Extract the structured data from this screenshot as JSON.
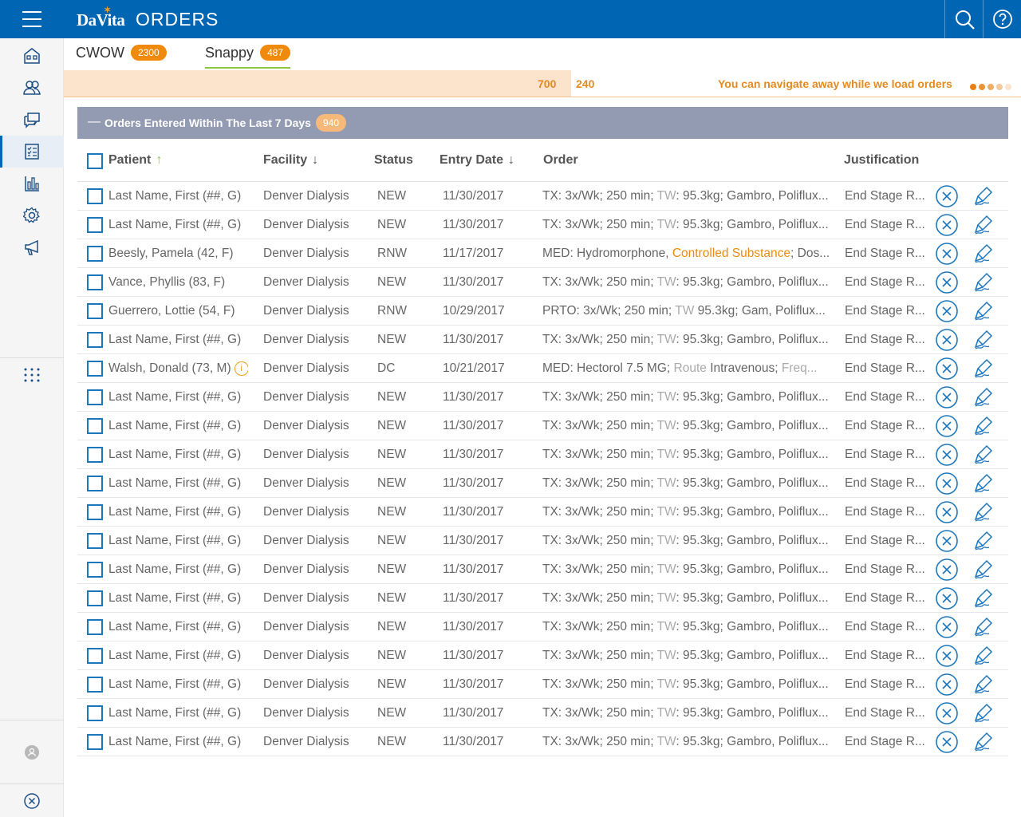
{
  "app": {
    "brand": "DaVita",
    "title": "ORDERS"
  },
  "topbar": {
    "search_icon": "search-icon",
    "help_icon": "help-icon"
  },
  "sidebar": {
    "items": [
      "home-icon",
      "patients-icon",
      "messages-icon",
      "orders-icon",
      "reports-icon",
      "settings-icon",
      "announcements-icon",
      "apps-grid-icon",
      "user-avatar",
      "close-icon"
    ],
    "active": "orders-icon"
  },
  "tabs": [
    {
      "label": "CWOW",
      "count": "2300"
    },
    {
      "label": "Snappy",
      "count": "487"
    }
  ],
  "loading": {
    "loaded_count": "700",
    "remaining_count": "240",
    "message": "You can navigate away while we load orders",
    "progress_fraction": 0.53
  },
  "group": {
    "title": "Orders Entered Within The Last 7 Days",
    "count": "940"
  },
  "columns": {
    "patient": "Patient",
    "facility": "Facility",
    "status": "Status",
    "entry_date": "Entry Date",
    "order": "Order",
    "justification": "Justification"
  },
  "rows": [
    {
      "patient": "Last Name, First (##, G)",
      "facility": "Denver Dialysis",
      "status": "NEW",
      "date": "11/30/2017",
      "order_type": "tx",
      "justification": "End Stage R..."
    },
    {
      "patient": "Last Name, First (##, G)",
      "facility": "Denver Dialysis",
      "status": "NEW",
      "date": "11/30/2017",
      "order_type": "tx",
      "justification": "End Stage R..."
    },
    {
      "patient": "Beesly, Pamela (42, F)",
      "facility": "Denver Dialysis",
      "status": "RNW",
      "date": "11/17/2017",
      "order_type": "med1",
      "justification": "End Stage R..."
    },
    {
      "patient": "Vance, Phyllis (83, F)",
      "facility": "Denver Dialysis",
      "status": "NEW",
      "date": "11/30/2017",
      "order_type": "tx",
      "justification": "End Stage R..."
    },
    {
      "patient": "Guerrero, Lottie (54, F)",
      "facility": "Denver Dialysis",
      "status": "RNW",
      "date": "10/29/2017",
      "order_type": "prto",
      "justification": "End Stage R..."
    },
    {
      "patient": "Last Name, First (##, G)",
      "facility": "Denver Dialysis",
      "status": "NEW",
      "date": "11/30/2017",
      "order_type": "tx",
      "justification": "End Stage R..."
    },
    {
      "patient": "Walsh, Donald (73, M)",
      "facility": "Denver Dialysis",
      "status": "DC",
      "date": "10/21/2017",
      "order_type": "med2",
      "justification": "End Stage R...",
      "info": true
    },
    {
      "patient": "Last Name, First (##, G)",
      "facility": "Denver Dialysis",
      "status": "NEW",
      "date": "11/30/2017",
      "order_type": "tx",
      "justification": "End Stage R..."
    },
    {
      "patient": "Last Name, First (##, G)",
      "facility": "Denver Dialysis",
      "status": "NEW",
      "date": "11/30/2017",
      "order_type": "tx",
      "justification": "End Stage R..."
    },
    {
      "patient": "Last Name, First (##, G)",
      "facility": "Denver Dialysis",
      "status": "NEW",
      "date": "11/30/2017",
      "order_type": "tx",
      "justification": "End Stage R..."
    },
    {
      "patient": "Last Name, First (##, G)",
      "facility": "Denver Dialysis",
      "status": "NEW",
      "date": "11/30/2017",
      "order_type": "tx",
      "justification": "End Stage R..."
    },
    {
      "patient": "Last Name, First (##, G)",
      "facility": "Denver Dialysis",
      "status": "NEW",
      "date": "11/30/2017",
      "order_type": "tx",
      "justification": "End Stage R..."
    },
    {
      "patient": "Last Name, First (##, G)",
      "facility": "Denver Dialysis",
      "status": "NEW",
      "date": "11/30/2017",
      "order_type": "tx",
      "justification": "End Stage R..."
    },
    {
      "patient": "Last Name, First (##, G)",
      "facility": "Denver Dialysis",
      "status": "NEW",
      "date": "11/30/2017",
      "order_type": "tx",
      "justification": "End Stage R..."
    },
    {
      "patient": "Last Name, First (##, G)",
      "facility": "Denver Dialysis",
      "status": "NEW",
      "date": "11/30/2017",
      "order_type": "tx",
      "justification": "End Stage R..."
    },
    {
      "patient": "Last Name, First (##, G)",
      "facility": "Denver Dialysis",
      "status": "NEW",
      "date": "11/30/2017",
      "order_type": "tx",
      "justification": "End Stage R..."
    },
    {
      "patient": "Last Name, First (##, G)",
      "facility": "Denver Dialysis",
      "status": "NEW",
      "date": "11/30/2017",
      "order_type": "tx",
      "justification": "End Stage R..."
    },
    {
      "patient": "Last Name, First (##, G)",
      "facility": "Denver Dialysis",
      "status": "NEW",
      "date": "11/30/2017",
      "order_type": "tx",
      "justification": "End Stage R..."
    },
    {
      "patient": "Last Name, First (##, G)",
      "facility": "Denver Dialysis",
      "status": "NEW",
      "date": "11/30/2017",
      "order_type": "tx",
      "justification": "End Stage R..."
    },
    {
      "patient": "Last Name, First (##, G)",
      "facility": "Denver Dialysis",
      "status": "NEW",
      "date": "11/30/2017",
      "order_type": "tx",
      "justification": "End Stage R..."
    }
  ],
  "orders": {
    "tx": [
      "TX: 3x/Wk; 250 min; ",
      "TW",
      ": 95.3kg; Gambro, Poliflux..."
    ],
    "med1": [
      "MED: Hydromorphone, ",
      "Controlled Substance",
      "; Dos..."
    ],
    "prto": [
      "PRTO: 3x/Wk; 250 min; ",
      "TW",
      " 95.3kg; Gam, Poliflux..."
    ],
    "med2": [
      "MED: Hectorol 7.5 MG; ",
      "Route",
      " Intravenous; ",
      "Freq..."
    ]
  },
  "colors": {
    "brand_blue": "#0065b3",
    "accent_orange": "#f08a0c",
    "group_bar": "#939bb3",
    "active_tab_underline": "#8dc63f"
  },
  "row_actions": {
    "cancel_icon": "cancel-circle-icon",
    "sign_icon": "sign-pen-icon"
  }
}
